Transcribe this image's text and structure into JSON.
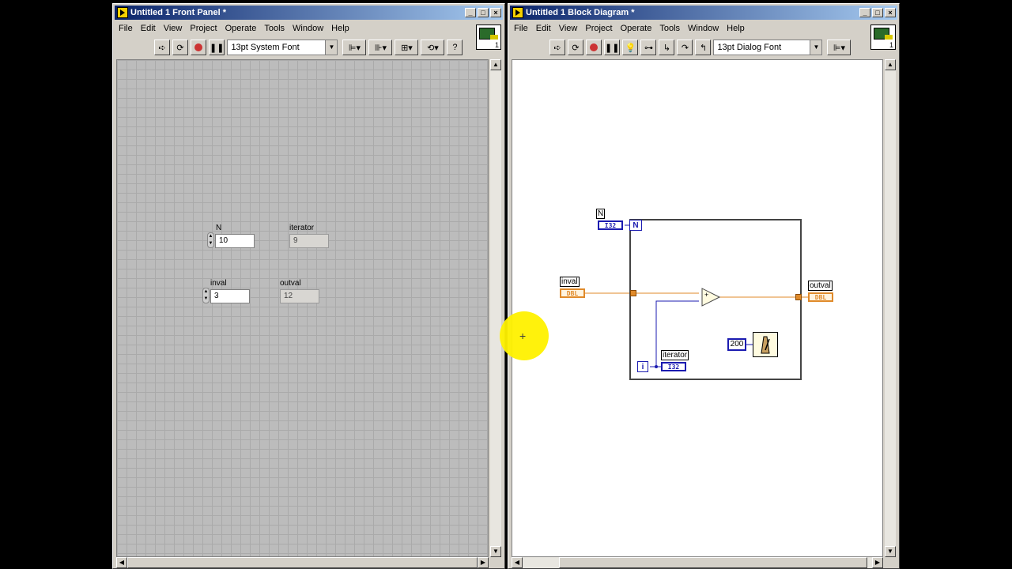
{
  "front_panel": {
    "title": "Untitled 1 Front Panel *",
    "menu": [
      "File",
      "Edit",
      "View",
      "Project",
      "Operate",
      "Tools",
      "Window",
      "Help"
    ],
    "font": "13pt System Font",
    "controls": {
      "n_label": "N",
      "n_value": "10",
      "iterator_label": "iterator",
      "iterator_value": "9",
      "inval_label": "inval",
      "inval_value": "3",
      "outval_label": "outval",
      "outval_value": "12"
    }
  },
  "block_diagram": {
    "title": "Untitled 1 Block Diagram *",
    "menu": [
      "File",
      "Edit",
      "View",
      "Project",
      "Operate",
      "Tools",
      "Window",
      "Help"
    ],
    "font": "13pt Dialog Font",
    "nodes": {
      "n_label": "N",
      "n_type": "I32",
      "count_terminal": "N",
      "inval_label": "inval",
      "inval_type": "DBL",
      "outval_label": "outval",
      "outval_type": "DBL",
      "iterator_label": "iterator",
      "iterator_type": "I32",
      "iteration_terminal": "i",
      "wait_constant": "200",
      "add_symbol": "+"
    }
  },
  "window_buttons": {
    "minimize": "_",
    "maximize": "□",
    "close": "×"
  },
  "vi_icon_number": "1",
  "colors": {
    "int_wire": "#1b1bb0",
    "dbl_wire": "#e08a2a",
    "highlight": "#fff200"
  }
}
